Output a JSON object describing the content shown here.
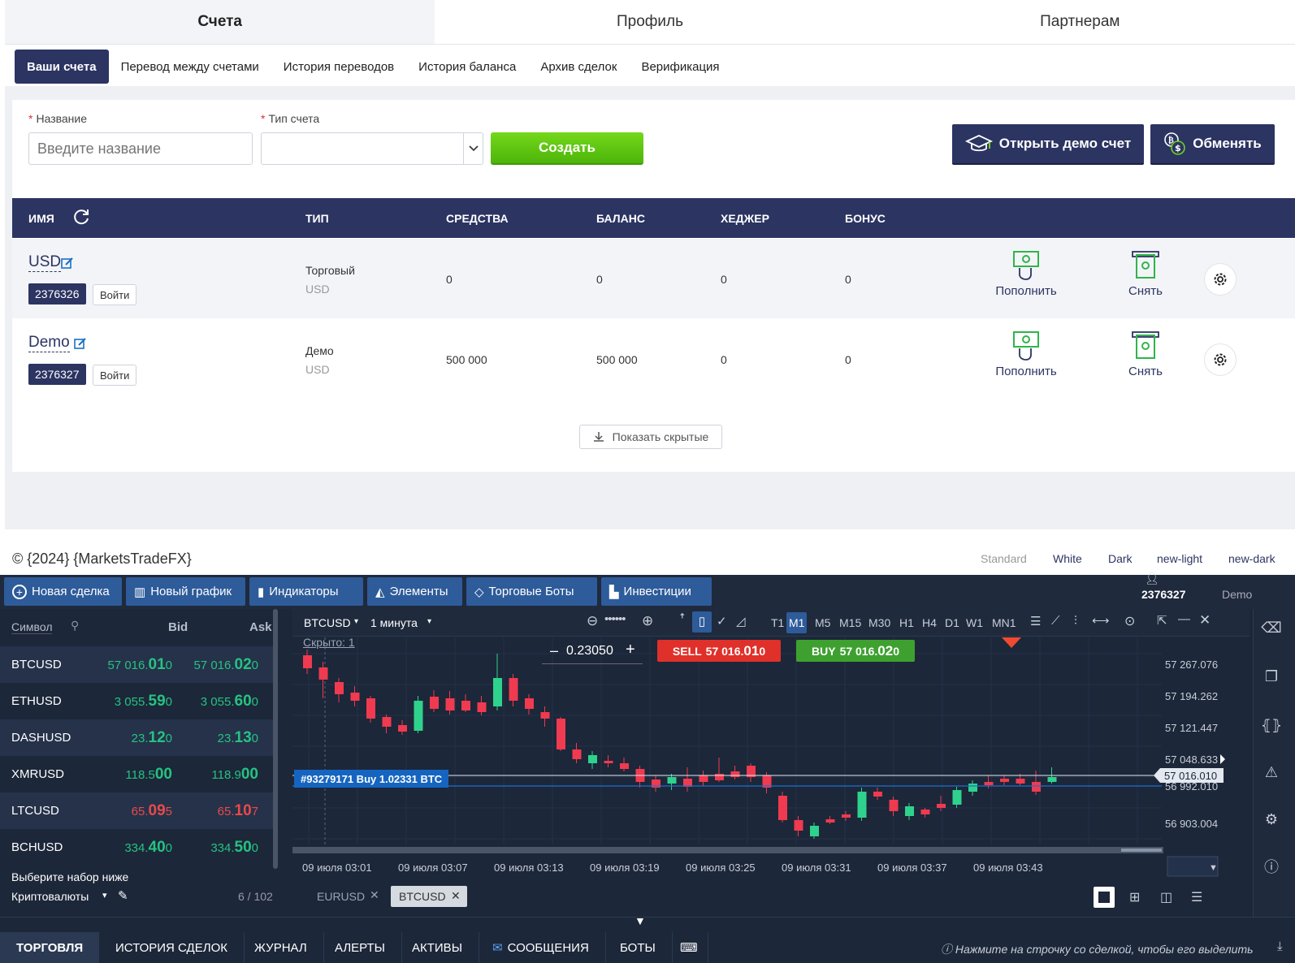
{
  "top_tabs": [
    "Счета",
    "Профиль",
    "Партнерам"
  ],
  "sub_tabs": [
    "Ваши счета",
    "Перевод между счетами",
    "История переводов",
    "История баланса",
    "Архив сделок",
    "Верификация"
  ],
  "form": {
    "name_label": "Название",
    "name_placeholder": "Введите название",
    "type_label": "Тип счета",
    "create_label": "Создать",
    "demo_label": "Открыть демо счет",
    "exchange_label": "Обменять"
  },
  "table": {
    "headers": [
      "ИМЯ",
      "ТИП",
      "СРЕДСТВА",
      "БАЛАНС",
      "ХЕДЖЕР",
      "БОНУС"
    ],
    "rows": [
      {
        "name": "USD",
        "id": "2376326",
        "login": "Войти",
        "type": "Торговый",
        "currency": "USD",
        "funds": "0",
        "balance": "0",
        "hedger": "0",
        "bonus": "0",
        "deposit": "Пополнить",
        "withdraw": "Снять"
      },
      {
        "name": "Demo",
        "id": "2376327",
        "login": "Войти",
        "type": "Демо",
        "currency": "USD",
        "funds": "500 000",
        "balance": "500 000",
        "hedger": "0",
        "bonus": "0",
        "deposit": "Пополнить",
        "withdraw": "Снять"
      }
    ],
    "show_hidden": "Показать скрытые"
  },
  "footer": {
    "copyright": "© {2024} {MarketsTradeFX}",
    "themes": [
      "Standard",
      "White",
      "Dark",
      "new-light",
      "new-dark"
    ]
  },
  "terminal": {
    "toolbar": [
      "Новая сделка",
      "Новый график",
      "Индикаторы",
      "Элементы",
      "Торговые Боты",
      "Инвестиции"
    ],
    "account_id": "2376327",
    "account_mode": "Demo",
    "symbols_header": {
      "symbol": "Символ",
      "bid": "Bid",
      "ask": "Ask"
    },
    "symbols": [
      {
        "sym": "BTCUSD",
        "bid_pre": "57 016.",
        "bid_big": "01",
        "bid_post": "0",
        "ask_pre": "57 016.",
        "ask_big": "02",
        "ask_post": "0",
        "dir": "up"
      },
      {
        "sym": "ETHUSD",
        "bid_pre": "3 055.",
        "bid_big": "59",
        "bid_post": "0",
        "ask_pre": "3 055.",
        "ask_big": "60",
        "ask_post": "0",
        "dir": "up"
      },
      {
        "sym": "DASHUSD",
        "bid_pre": "23.",
        "bid_big": "12",
        "bid_post": "0",
        "ask_pre": "23.",
        "ask_big": "13",
        "ask_post": "0",
        "dir": "up"
      },
      {
        "sym": "XMRUSD",
        "bid_pre": "118.5",
        "bid_big": "00",
        "bid_post": "",
        "ask_pre": "118.9",
        "ask_big": "00",
        "ask_post": "",
        "dir": "up"
      },
      {
        "sym": "LTCUSD",
        "bid_pre": "65.",
        "bid_big": "09",
        "bid_post": "5",
        "ask_pre": "65.",
        "ask_big": "10",
        "ask_post": "7",
        "dir": "dn"
      },
      {
        "sym": "BCHUSD",
        "bid_pre": "334.",
        "bid_big": "40",
        "bid_post": "0",
        "ask_pre": "334.",
        "ask_big": "50",
        "ask_post": "0",
        "dir": "up"
      }
    ],
    "set_hint": "Выберите набор ниже",
    "set_name": "Криптовалюты",
    "set_count": "6 / 102",
    "chart": {
      "symbol": "BTCUSD",
      "timeframe": "1 минута",
      "periods": [
        "T1",
        "M1",
        "M5",
        "M15",
        "M30",
        "H1",
        "H4",
        "D1",
        "W1",
        "MN1"
      ],
      "hidden": "Скрыто: 1",
      "lot": "0.23050",
      "sell_label": "SELL",
      "sell_pre": "57 016.",
      "sell_big": "01",
      "sell_post": "0",
      "buy_label": "BUY",
      "buy_pre": "57 016.",
      "buy_big": "02",
      "buy_post": "0",
      "order_label": "#93279171 Buy 1.02331 BTC",
      "price_ticks": [
        "57 267.076",
        "57 194.262",
        "57 121.447",
        "57 048.633",
        "56 992.010",
        "56 903.004"
      ],
      "current_price": "57 016.010",
      "time_ticks": [
        "09 июля 03:01",
        "09 июля 03:07",
        "09 июля 03:13",
        "09 июля 03:19",
        "09 июля 03:25",
        "09 июля 03:31",
        "09 июля 03:37",
        "09 июля 03:43"
      ]
    },
    "chart_tabs": [
      "EURUSD",
      "BTCUSD"
    ],
    "bottom_tabs": [
      "ТОРГОВЛЯ",
      "ИСТОРИЯ СДЕЛОК",
      "ЖУРНАЛ",
      "АЛЕРТЫ",
      "АКТИВЫ",
      "СООБЩЕНИЯ",
      "БОТЫ"
    ],
    "hint": "Нажмите на строчку со сделкой, чтобы его выделить"
  }
}
